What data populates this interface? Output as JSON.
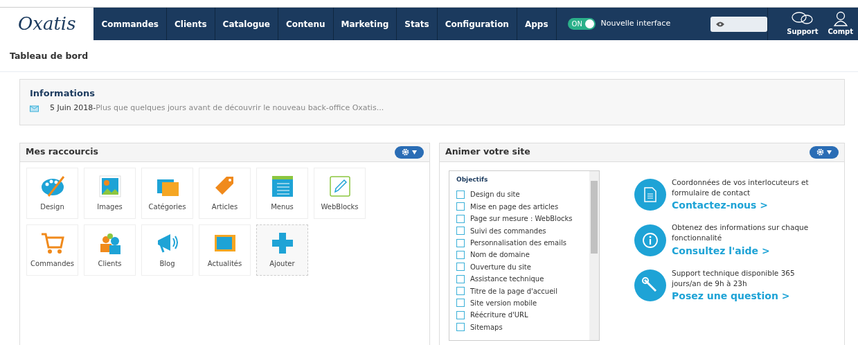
{
  "logo": "Oxatis",
  "nav": [
    {
      "label": "Commandes"
    },
    {
      "label": "Clients"
    },
    {
      "label": "Catalogue"
    },
    {
      "label": "Contenu"
    },
    {
      "label": "Marketing"
    },
    {
      "label": "Stats"
    },
    {
      "label": "Configuration"
    },
    {
      "label": "Apps"
    }
  ],
  "toggle": {
    "on": true,
    "state_label": "ON",
    "label": "Nouvelle interface"
  },
  "user_menu": [
    {
      "label": "Support"
    },
    {
      "label": "Compt"
    }
  ],
  "page_title": "Tableau de bord",
  "informations": {
    "title": "Informations",
    "date": "5 Juin 2018-",
    "text": "Plus que quelques jours avant de découvrir le nouveau back-office Oxatis..."
  },
  "shortcuts": {
    "title": "Mes raccourcis",
    "items": [
      {
        "label": "Design",
        "kind": "shortcut"
      },
      {
        "label": "Images",
        "kind": "shortcut"
      },
      {
        "label": "Catégories",
        "kind": "shortcut"
      },
      {
        "label": "Articles",
        "kind": "shortcut"
      },
      {
        "label": "Menus",
        "kind": "shortcut"
      },
      {
        "label": "WebBlocks",
        "kind": "shortcut"
      },
      {
        "label": "Commandes",
        "kind": "shortcut"
      },
      {
        "label": "Clients",
        "kind": "shortcut"
      },
      {
        "label": "Blog",
        "kind": "shortcut"
      },
      {
        "label": "Actualités",
        "kind": "shortcut"
      },
      {
        "label": "Ajouter",
        "kind": "add"
      }
    ]
  },
  "animate": {
    "title": "Animer votre site",
    "objectives_title": "Objectifs",
    "objectives": [
      {
        "label": "Design du site",
        "checked": false
      },
      {
        "label": "Mise en page des articles",
        "checked": false
      },
      {
        "label": "Page sur mesure : WebBlocks",
        "checked": false
      },
      {
        "label": "Suivi des commandes",
        "checked": false
      },
      {
        "label": "Personnalisation des emails",
        "checked": false
      },
      {
        "label": "Nom de domaine",
        "checked": false
      },
      {
        "label": "Ouverture du site",
        "checked": false
      },
      {
        "label": "Assistance technique",
        "checked": false
      },
      {
        "label": "Titre de la page d'accueil",
        "checked": false
      },
      {
        "label": "Site version mobile",
        "checked": false
      },
      {
        "label": "Réécriture d'URL",
        "checked": false
      },
      {
        "label": "Sitemaps",
        "checked": false
      }
    ],
    "help": [
      {
        "text": "Coordonnées de vos interlocuteurs et formulaire de contact",
        "link": "Contactez-nous >"
      },
      {
        "text": "Obtenez des informations sur chaque fonctionnalité",
        "link": "Consultez l'aide >"
      },
      {
        "text": "Support technique disponible 365 jours/an de 9h à 23h",
        "link": "Posez une question >"
      }
    ]
  }
}
